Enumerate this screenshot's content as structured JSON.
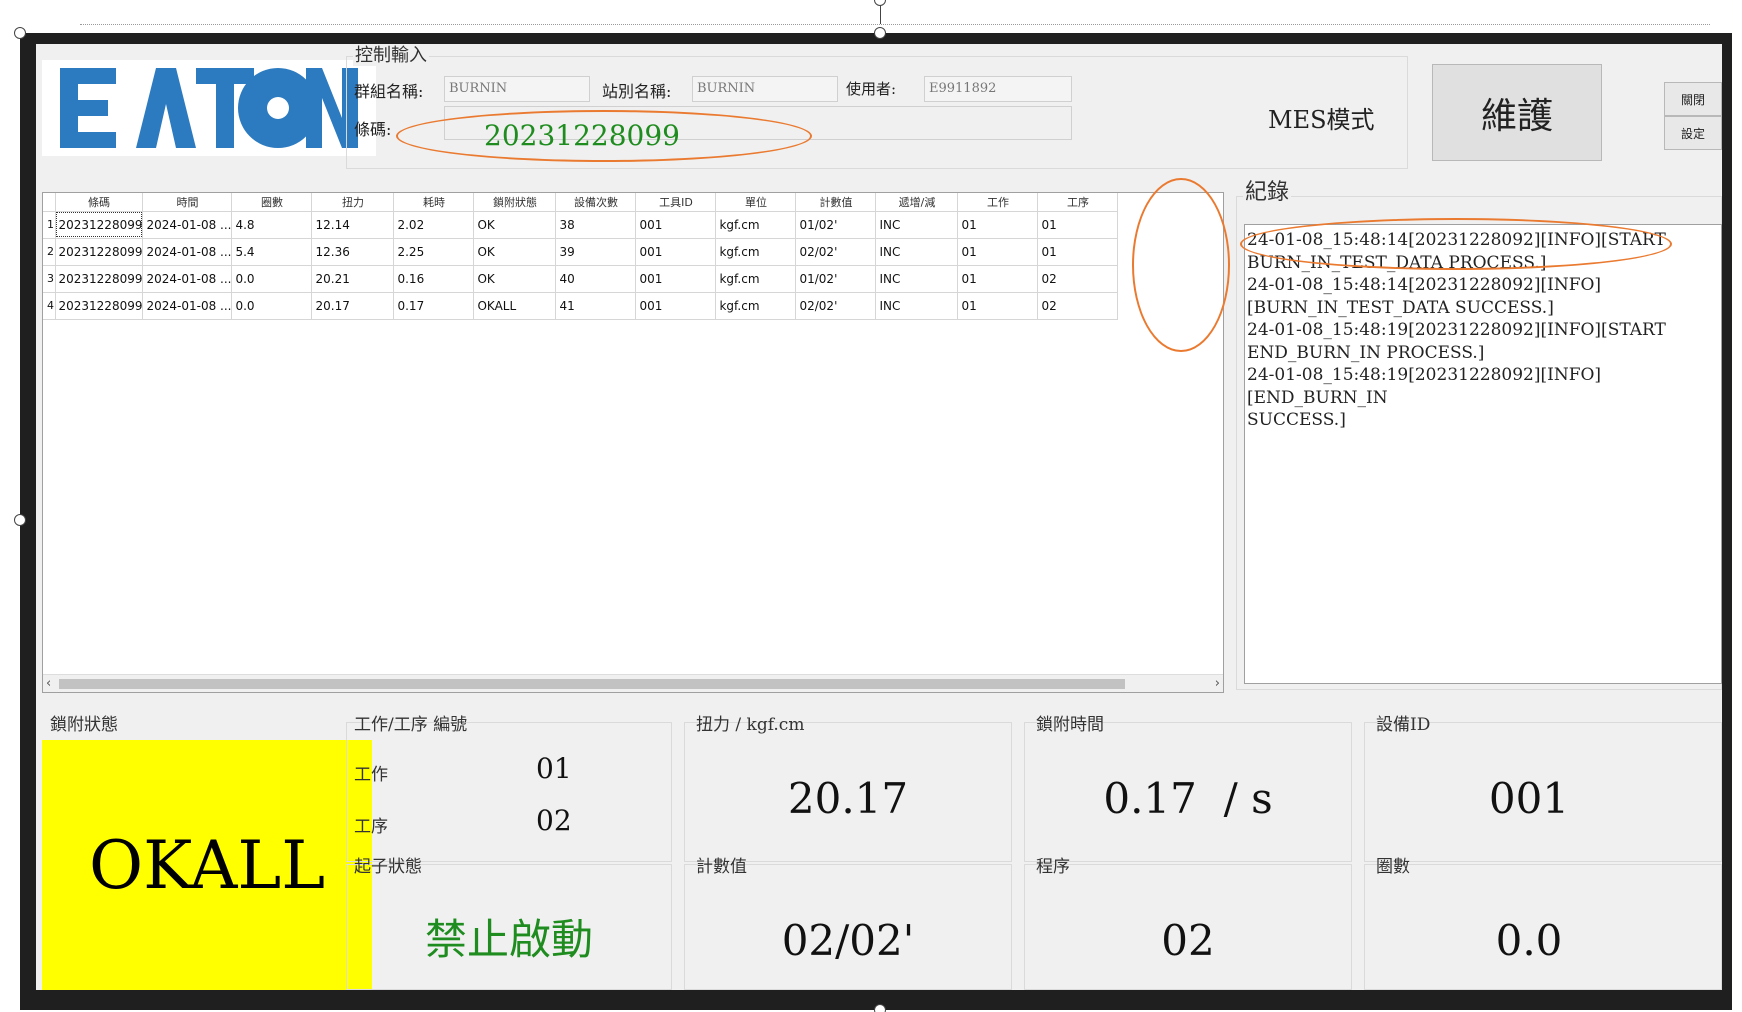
{
  "control": {
    "title": "控制輸入",
    "group_label": "群組名稱:",
    "group_value": "BURNIN",
    "station_label": "站別名稱:",
    "station_value": "BURNIN",
    "user_label": "使用者:",
    "user_value": "E9911892",
    "barcode_label": "條碼:",
    "barcode_value": "20231228099"
  },
  "mode_label": "MES模式",
  "main_button": "維護",
  "close_button": "關閉",
  "settings_button": "設定",
  "table": {
    "headers": [
      "條碼",
      "時間",
      "圈數",
      "扭力",
      "耗時",
      "鎖附狀態",
      "設備次數",
      "工具ID",
      "單位",
      "計數值",
      "遞增/減",
      "工作",
      "工序"
    ],
    "rows": [
      [
        "1",
        "20231228099",
        "2024-01-08 ...",
        "4.8",
        "12.14",
        "2.02",
        "OK",
        "38",
        "001",
        "kgf.cm",
        "01/02'",
        "INC",
        "01",
        "01"
      ],
      [
        "2",
        "20231228099",
        "2024-01-08 ...",
        "5.4",
        "12.36",
        "2.25",
        "OK",
        "39",
        "001",
        "kgf.cm",
        "02/02'",
        "INC",
        "01",
        "01"
      ],
      [
        "3",
        "20231228099",
        "2024-01-08 ...",
        "0.0",
        "20.21",
        "0.16",
        "OK",
        "40",
        "001",
        "kgf.cm",
        "01/02'",
        "INC",
        "01",
        "02"
      ],
      [
        "4",
        "20231228099",
        "2024-01-08 ...",
        "0.0",
        "20.17",
        "0.17",
        "OKALL",
        "41",
        "001",
        "kgf.cm",
        "02/02'",
        "INC",
        "01",
        "02"
      ]
    ]
  },
  "log": {
    "title": "紀錄",
    "lines": [
      "24-01-08_15:48:14[20231228092][INFO][START",
      "BURN_IN_TEST_DATA PROCESS.]",
      "24-01-08_15:48:14[20231228092][INFO]",
      "[BURN_IN_TEST_DATA SUCCESS.]",
      "24-01-08_15:48:19[20231228092][INFO][START",
      "END_BURN_IN PROCESS.]",
      "24-01-08_15:48:19[20231228092][INFO][END_BURN_IN",
      "SUCCESS.]"
    ]
  },
  "panels": {
    "lock_status_title": "鎖附狀態",
    "lock_status_value": "OKALL",
    "job_title": "工作/工序 編號",
    "job_label": "工作",
    "job_value": "01",
    "step_label": "工序",
    "step_value": "02",
    "torque_title": "扭力 / kgf.cm",
    "torque_value": "20.17",
    "lock_time_title": "鎖附時間",
    "lock_time_value": "0.17  / s",
    "device_id_title": "設備ID",
    "device_id_value": "001",
    "driver_status_title": "起子狀態",
    "driver_status_value": "禁止啟動",
    "count_title": "計數值",
    "count_value": "02/02'",
    "program_title": "程序",
    "program_value": "02",
    "turns_title": "圈數",
    "turns_value": "0.0"
  },
  "colors": {
    "barcode": "#1f8c1f",
    "driver_status": "#1f8c1f",
    "lock_status_bg": "#ffff00",
    "annotation": "#ea7a30",
    "logo": "#2c7bc0"
  }
}
